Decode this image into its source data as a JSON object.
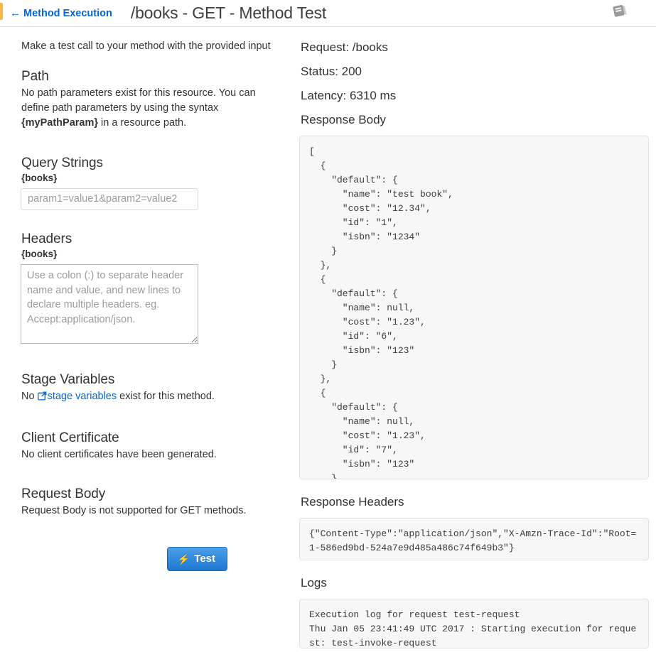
{
  "header": {
    "back_label": "Method Execution",
    "back_arrow": "←",
    "title": "/books - GET - Method Test",
    "docs_icon": "book-icon",
    "accent_color": "#f5b74e",
    "link_color": "#0366d6"
  },
  "left": {
    "intro": "Make a test call to your method with the provided input",
    "path": {
      "heading": "Path",
      "text_before": "No path parameters exist for this resource. You can define path parameters by using the syntax ",
      "param_token": "{myPathParam}",
      "text_after": " in a resource path."
    },
    "query_strings": {
      "heading": "Query Strings",
      "resource": "{books}",
      "input_value": "",
      "placeholder": "param1=value1&param2=value2"
    },
    "headers": {
      "heading": "Headers",
      "resource": "{books}",
      "textarea_value": "",
      "placeholder": "Use a colon (:) to separate header name and value, and new lines to declare multiple headers. eg. Accept:application/json."
    },
    "stage_variables": {
      "heading": "Stage Variables",
      "text_before": "No ",
      "link_label": "stage variables",
      "link_icon": "external-link-icon",
      "text_after": " exist for this method."
    },
    "client_certificate": {
      "heading": "Client Certificate",
      "text": "No client certificates have been generated."
    },
    "request_body": {
      "heading": "Request Body",
      "text": "Request Body is not supported for GET methods."
    },
    "test_button": {
      "label": "Test",
      "icon": "lightning-bolt-icon",
      "color": "#1e78d0"
    }
  },
  "right": {
    "request_line": "Request: /books",
    "status_line": "Status: 200",
    "latency_line": "Latency: 6310 ms",
    "response_body_heading": "Response Body",
    "response_body": "[\n  {\n    \"default\": {\n      \"name\": \"test book\",\n      \"cost\": \"12.34\",\n      \"id\": \"1\",\n      \"isbn\": \"1234\"\n    }\n  },\n  {\n    \"default\": {\n      \"name\": null,\n      \"cost\": \"1.23\",\n      \"id\": \"6\",\n      \"isbn\": \"123\"\n    }\n  },\n  {\n    \"default\": {\n      \"name\": null,\n      \"cost\": \"1.23\",\n      \"id\": \"7\",\n      \"isbn\": \"123\"\n    }\n  }\n]",
    "response_headers_heading": "Response Headers",
    "response_headers": "{\"Content-Type\":\"application/json\",\"X-Amzn-Trace-Id\":\"Root=1-586ed9bd-524a7e9d485a486c74f649b3\"}",
    "logs_heading": "Logs",
    "logs": "Execution log for request test-request\nThu Jan 05 23:41:49 UTC 2017 : Starting execution for request: test-invoke-request"
  }
}
